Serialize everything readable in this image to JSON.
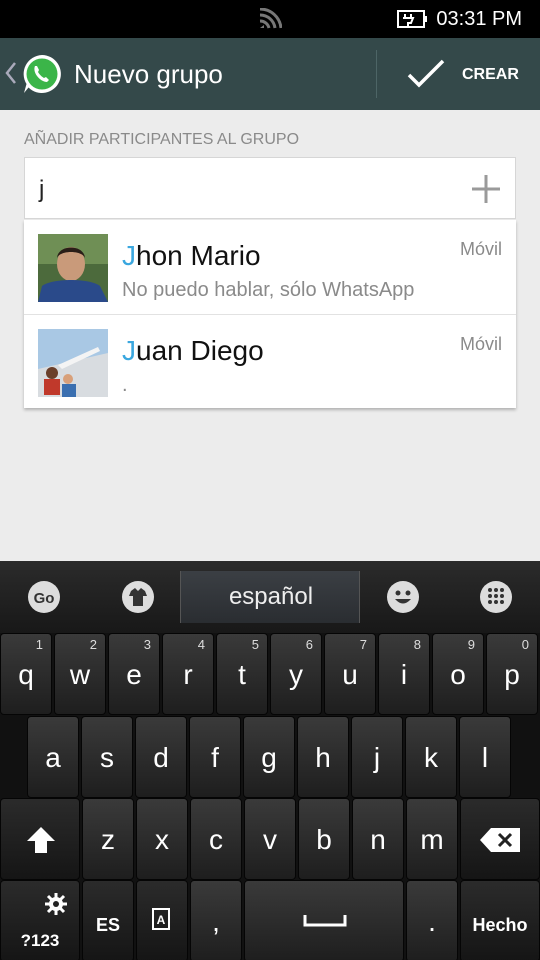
{
  "status_bar": {
    "time": "03:31 PM",
    "signal_icon": "wifi-signal-icon",
    "battery_icon": "battery-charging-icon"
  },
  "action_bar": {
    "title": "Nuevo grupo",
    "back_icon": "chevron-left-icon",
    "logo": "whatsapp-logo",
    "confirm_icon": "checkmark-icon",
    "confirm_label": "CREAR"
  },
  "content": {
    "section_label": "AÑADIR PARTICIPANTES AL GRUPO",
    "search": {
      "query": "j",
      "add_icon": "plus-icon"
    },
    "contacts": [
      {
        "name_highlight": "J",
        "name_rest": "hon Mario",
        "status": "No puedo hablar, sólo WhatsApp",
        "type": "Móvil"
      },
      {
        "name_highlight": "J",
        "name_rest": "uan Diego",
        "status": ".",
        "type": "Móvil"
      }
    ]
  },
  "keyboard": {
    "language": "español",
    "row1": [
      {
        "k": "q",
        "n": "1"
      },
      {
        "k": "w",
        "n": "2"
      },
      {
        "k": "e",
        "n": "3"
      },
      {
        "k": "r",
        "n": "4"
      },
      {
        "k": "t",
        "n": "5"
      },
      {
        "k": "y",
        "n": "6"
      },
      {
        "k": "u",
        "n": "7"
      },
      {
        "k": "i",
        "n": "8"
      },
      {
        "k": "o",
        "n": "9"
      },
      {
        "k": "p",
        "n": "0"
      }
    ],
    "row2": [
      "a",
      "s",
      "d",
      "f",
      "g",
      "h",
      "j",
      "k",
      "l"
    ],
    "row3": [
      "z",
      "x",
      "c",
      "v",
      "b",
      "n",
      "m"
    ],
    "symbols_label": "?123",
    "lang_key_label": "ES",
    "comma": ",",
    "period": ".",
    "done_label": "Hecho"
  }
}
